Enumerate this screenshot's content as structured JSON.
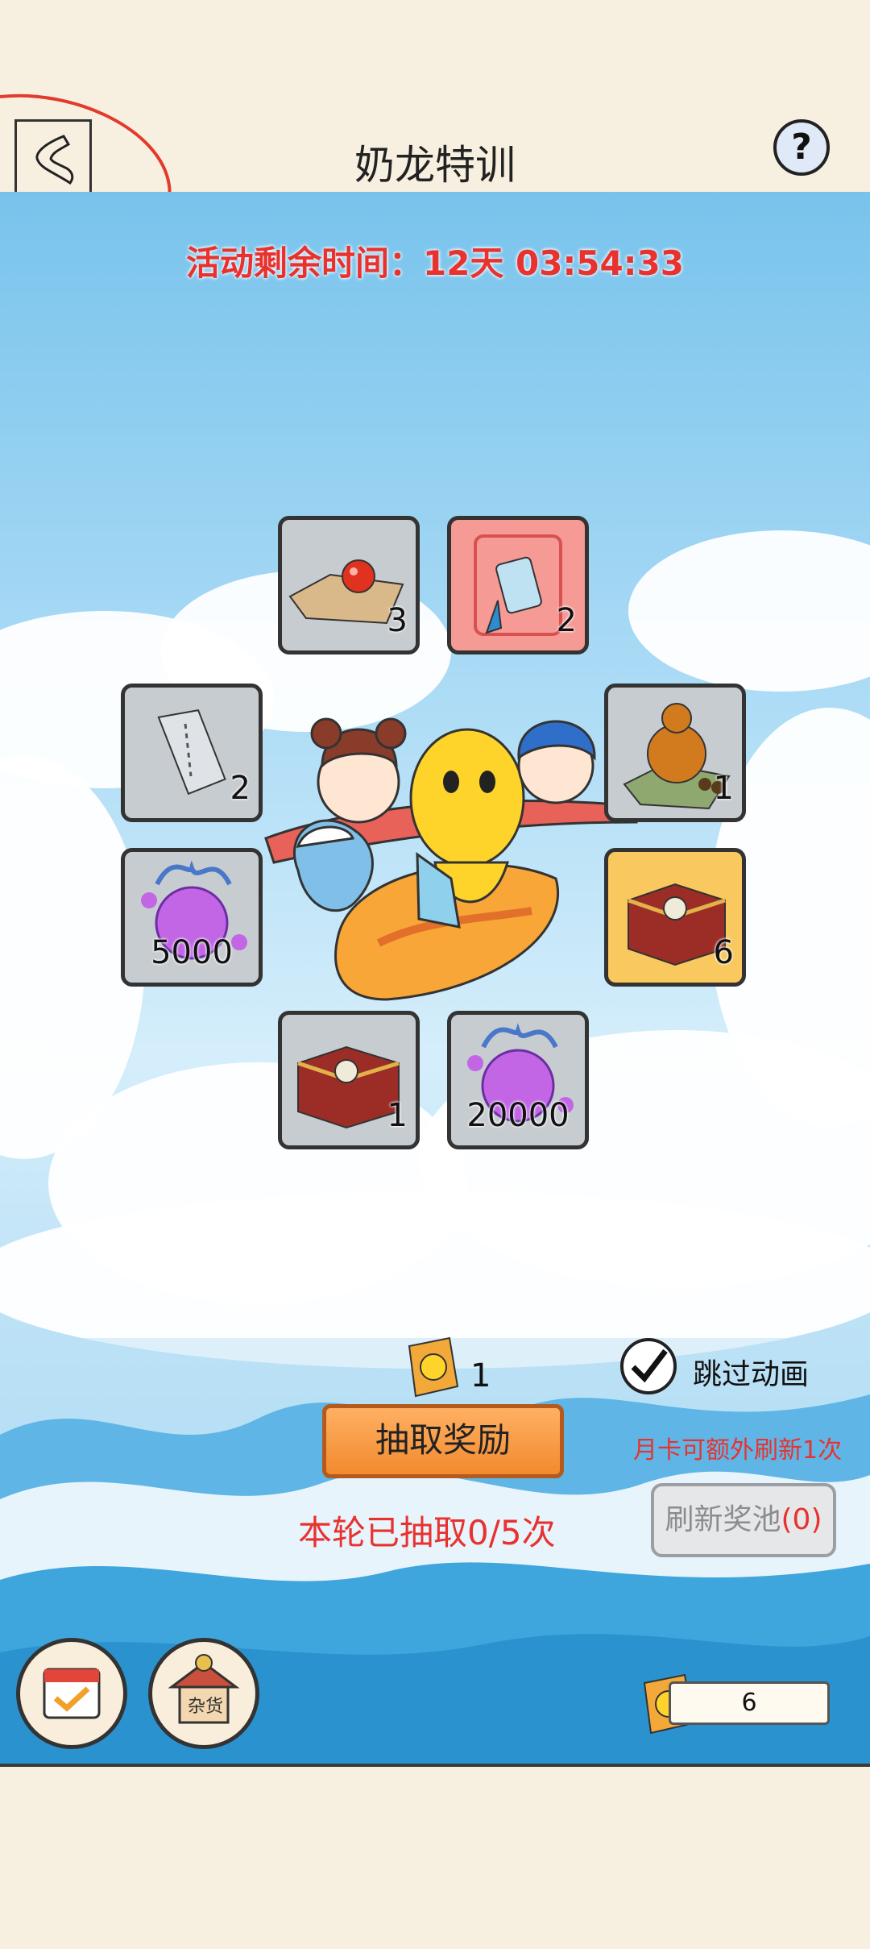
{
  "header": {
    "title": "奶龙特训",
    "help_label": "?"
  },
  "event": {
    "timer_text": "活动剩余时间：12天 03:54:33"
  },
  "rewards": [
    {
      "name": "red-orb-scroll",
      "count": "3"
    },
    {
      "name": "blue-charm",
      "count": "2"
    },
    {
      "name": "silver-ticket",
      "count": "2"
    },
    {
      "name": "gourd-item",
      "count": "1"
    },
    {
      "name": "potential-orb",
      "count": "5000"
    },
    {
      "name": "treasure-chest-gold",
      "count": "6"
    },
    {
      "name": "treasure-chest",
      "count": "1"
    },
    {
      "name": "potential-orb-large",
      "count": "20000"
    }
  ],
  "draw": {
    "ticket_count": "1",
    "skip_label": "跳过动画",
    "button_label": "抽取奖励",
    "monthly_note": "月卡可额外刷新1次",
    "draws_text": "本轮已抽取0/5次",
    "refresh_label": "刷新奖池",
    "refresh_count": "(0)"
  },
  "bottom": {
    "shop_label": "杂货",
    "currency_count": "6"
  },
  "colors": {
    "accent_red": "#e8322f",
    "button_orange": "#f28a2e",
    "paper": "#f7f0e0"
  }
}
